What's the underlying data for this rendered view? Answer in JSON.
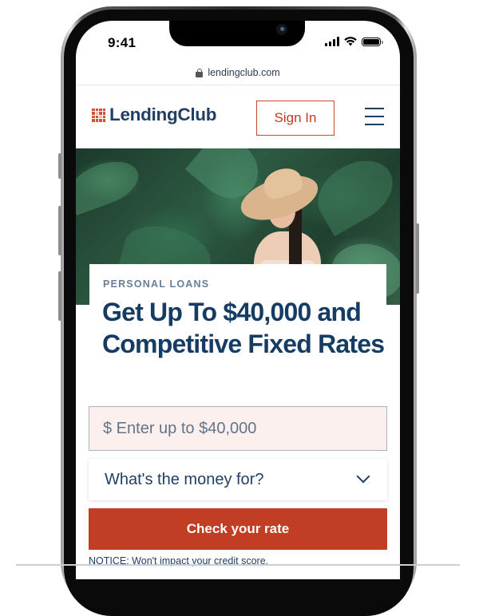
{
  "status_bar": {
    "time": "9:41",
    "icons": [
      "cellular-signal-icon",
      "wifi-icon",
      "battery-icon"
    ]
  },
  "browser": {
    "url": "lendingclub.com",
    "secure_icon": "lock-icon"
  },
  "nav": {
    "brand": "LendingClub",
    "sign_in_label": "Sign In",
    "menu_icon": "hamburger-menu-icon"
  },
  "hero": {
    "image_alt": "Woman in straw sun hat smiling in front of tropical leaves"
  },
  "card": {
    "eyebrow": "PERSONAL LOANS",
    "headline": "Get Up To $40,000 and Competitive Fixed Rates"
  },
  "form": {
    "amount_placeholder": "$ Enter up to $40,000",
    "amount_value": "",
    "purpose_placeholder": "What's the money for?",
    "submit_label": "Check your rate",
    "notice": "NOTICE: Won't impact your credit score."
  },
  "colors": {
    "brand_navy": "#163c63",
    "brand_red": "#c13d23",
    "input_bg": "#fcf0ef"
  }
}
